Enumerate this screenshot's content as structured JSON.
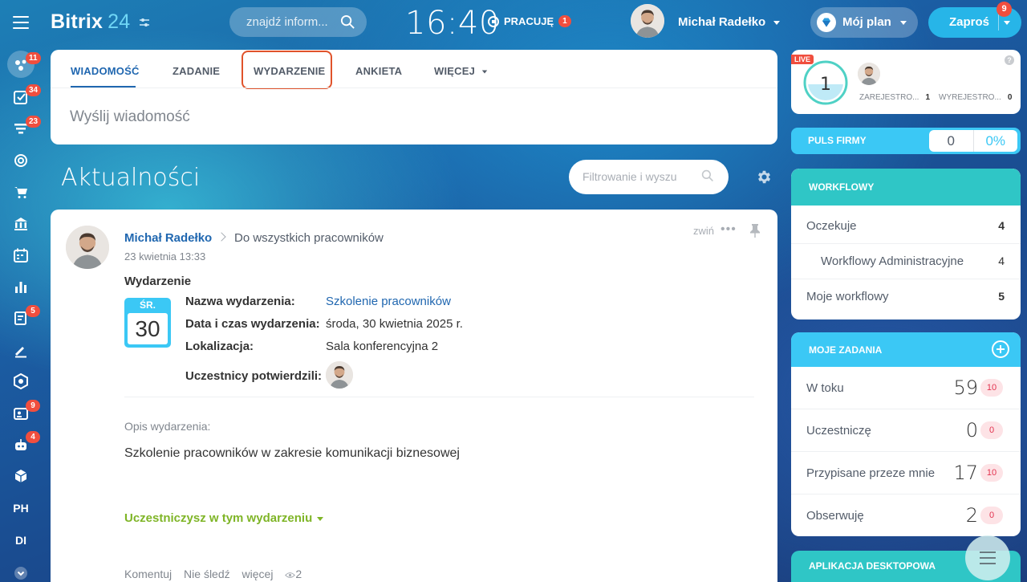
{
  "header": {
    "logo_main": "Bitrix",
    "logo_num": "24",
    "search_placeholder": "znajdź inform...",
    "clock": "16:40",
    "status_label": "PRACUJĘ",
    "status_badge": "1",
    "user_name": "Michał Radełko",
    "plan_label": "Mój plan",
    "invite_label": "Zaproś",
    "invite_badge": "9"
  },
  "sidebar": {
    "badges": [
      "11",
      "34",
      "23",
      "5",
      "9",
      "4"
    ],
    "texts": [
      "PH",
      "DI"
    ]
  },
  "composer": {
    "tabs": [
      "WIADOMOŚĆ",
      "ZADANIE",
      "WYDARZENIE",
      "ANKIETA",
      "WIĘCEJ"
    ],
    "placeholder": "Wyślij wiadomość"
  },
  "feed": {
    "title": "Aktualności",
    "filter_placeholder": "Filtrowanie i wyszu"
  },
  "post": {
    "author": "Michał Radełko",
    "destination": "Do wszystkich pracowników",
    "date": "23 kwietnia 13:33",
    "collapse": "zwiń",
    "type": "Wydarzenie",
    "cal_day": "ŚR.",
    "cal_num": "30",
    "fields": {
      "name_label": "Nazwa wydarzenia:",
      "name_value": "Szkolenie pracowników",
      "datetime_label": "Data i czas wydarzenia:",
      "datetime_value": "środa, 30 kwietnia 2025 r.",
      "location_label": "Lokalizacja:",
      "location_value": "Sala konferencyjna 2",
      "participants_label": "Uczestnicy potwierdzili:"
    },
    "desc_label": "Opis wydarzenia:",
    "desc": "Szkolenie pracowników w zakresie komunikacji biznesowej",
    "attend": "Uczestniczysz w tym wydarzeniu",
    "actions": {
      "comment": "Komentuj",
      "unfollow": "Nie śledź",
      "more": "więcej",
      "views": "2"
    }
  },
  "live_widget": {
    "tag": "LIVE",
    "count": "1",
    "registered_label": "ZAREJESTRO...",
    "registered_value": "1",
    "unregistered_label": "WYREJESTRO...",
    "unregistered_value": "0"
  },
  "puls": {
    "label": "PULS FIRMY",
    "value": "0",
    "percent": "0%"
  },
  "workflows": {
    "title": "WORKFLOWY",
    "rows": [
      {
        "label": "Oczekuje",
        "value": "4"
      },
      {
        "label": "Workflowy Administracyjne",
        "value": "4"
      },
      {
        "label": "Moje workflowy",
        "value": "5"
      }
    ]
  },
  "tasks": {
    "title": "MOJE ZADANIA",
    "rows": [
      {
        "label": "W toku",
        "value": "59",
        "counter": "10"
      },
      {
        "label": "Uczestniczę",
        "value": "0",
        "counter": "0"
      },
      {
        "label": "Przypisane przeze mnie",
        "value": "17",
        "counter": "10"
      },
      {
        "label": "Obserwuję",
        "value": "2",
        "counter": "0"
      }
    ]
  },
  "desktop_app": {
    "title": "APLIKACJA DESKTOPOWA"
  },
  "colors": {
    "accent": "#2067b0",
    "highlight": "#e0532b",
    "badge": "#f04e3e",
    "teal": "#2fc6c6",
    "sky": "#3bc8f5",
    "green": "#7fb527"
  }
}
